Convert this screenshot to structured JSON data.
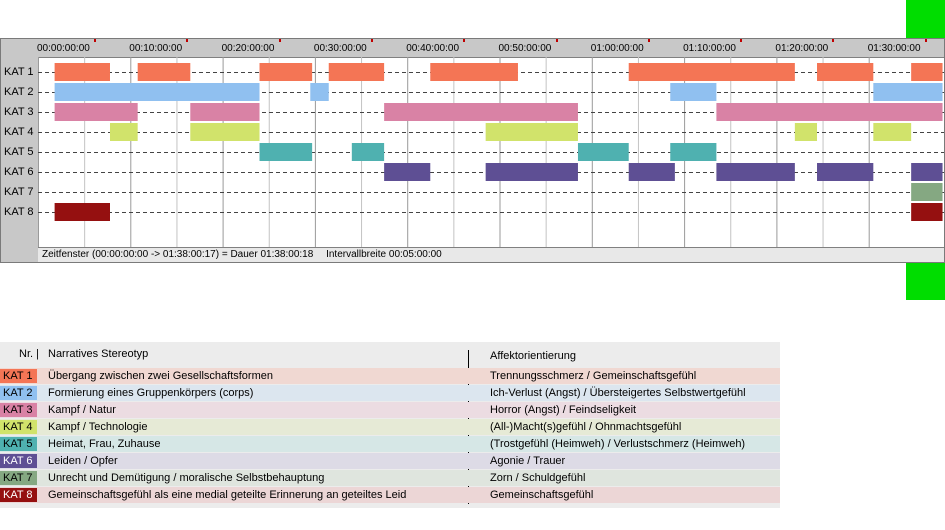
{
  "chart_data": {
    "type": "timeline",
    "categories": [
      "KAT 1",
      "KAT 2",
      "KAT 3",
      "KAT 4",
      "KAT 5",
      "KAT 6",
      "KAT 7",
      "KAT 8"
    ],
    "x_unit": "minutes",
    "xlim": [
      0,
      94.6
    ],
    "ticks": [
      {
        "min": 0,
        "label": "00:00:00:00"
      },
      {
        "min": 10,
        "label": "00:10:00:00"
      },
      {
        "min": 20,
        "label": "00:20:00:00"
      },
      {
        "min": 30,
        "label": "00:30:00:00"
      },
      {
        "min": 40,
        "label": "00:40:00:00"
      },
      {
        "min": 50,
        "label": "00:50:00:00"
      },
      {
        "min": 60,
        "label": "01:00:00:00"
      },
      {
        "min": 70,
        "label": "01:10:00:00"
      },
      {
        "min": 80,
        "label": "01:20:00:00"
      },
      {
        "min": 90,
        "label": "01:30:00:00"
      }
    ],
    "series": [
      {
        "color": "#f47555",
        "intervals": [
          [
            1.8,
            7.8
          ],
          [
            10.8,
            16.5
          ],
          [
            24,
            29.7
          ],
          [
            31.5,
            37.5
          ],
          [
            42.5,
            52
          ],
          [
            64,
            82
          ],
          [
            84.4,
            90.5
          ],
          [
            94.6,
            98
          ]
        ]
      },
      {
        "color": "#90c0f0",
        "intervals": [
          [
            1.8,
            24
          ],
          [
            29.5,
            31.5
          ],
          [
            68.5,
            73.5
          ],
          [
            90.5,
            98
          ]
        ]
      },
      {
        "color": "#d982a5",
        "intervals": [
          [
            1.8,
            10.8
          ],
          [
            16.5,
            24
          ],
          [
            37.5,
            58.5
          ],
          [
            73.5,
            98
          ]
        ]
      },
      {
        "color": "#d1e36b",
        "intervals": [
          [
            7.8,
            10.8
          ],
          [
            16.5,
            24
          ],
          [
            48.5,
            58.5
          ],
          [
            82,
            84.4
          ],
          [
            90.5,
            94.6
          ]
        ]
      },
      {
        "color": "#4fb1b0",
        "intervals": [
          [
            24,
            29.7
          ],
          [
            34,
            37.5
          ],
          [
            58.5,
            64
          ],
          [
            68.5,
            73.5
          ]
        ]
      },
      {
        "color": "#5e4f94",
        "intervals": [
          [
            37.5,
            42.5
          ],
          [
            48.5,
            58.5
          ],
          [
            64,
            69
          ],
          [
            73.5,
            82
          ],
          [
            84.4,
            90.5
          ],
          [
            94.6,
            98
          ]
        ]
      },
      {
        "color": "#85a882",
        "intervals": [
          [
            94.6,
            98
          ]
        ]
      },
      {
        "color": "#951010",
        "intervals": [
          [
            1.8,
            7.8
          ],
          [
            94.6,
            98
          ]
        ]
      }
    ]
  },
  "status": {
    "zeitfenster": "Zeitfenster (00:00:00:00 -> 01:38:00:17) = Dauer 01:38:00:18",
    "intervall": "Intervallbreite 00:05:00:00"
  },
  "legend": {
    "header_nr": "Nr. |",
    "header_stereotyp": "Narratives Stereotyp",
    "header_affekt": "Affektorientierung",
    "rows": [
      {
        "kat": "KAT 1",
        "badge": "#f47555",
        "bg": "#f0d8d2",
        "stereotyp": "Übergang zwischen zwei Gesellschaftsformen",
        "affekt": "Trennungsschmerz / Gemeinschaftsgefühl"
      },
      {
        "kat": "KAT 2",
        "badge": "#90c0f0",
        "bg": "#dce6ef",
        "stereotyp": "Formierung eines Gruppenkörpers (corps)",
        "affekt": "Ich-Verlust (Angst) / Übersteigertes Selbstwertgefühl"
      },
      {
        "kat": "KAT 3",
        "badge": "#d982a5",
        "bg": "#ecdce2",
        "stereotyp": "Kampf / Natur",
        "affekt": "Horror (Angst) / Feindseligkeit"
      },
      {
        "kat": "KAT 4",
        "badge": "#d1e36b",
        "bg": "#e6ead6",
        "stereotyp": "Kampf / Technologie",
        "affekt": "(All-)Macht(s)gefühl / Ohnmachtsgefühl"
      },
      {
        "kat": "KAT 5",
        "badge": "#4fb1b0",
        "bg": "#d6e7e6",
        "stereotyp": "Heimat, Frau, Zuhause",
        "affekt": "(Trostgefühl (Heimweh) / Verlustschmerz (Heimweh)"
      },
      {
        "kat": "KAT 6",
        "badge": "#5e4f94",
        "bg": "#dddbe6",
        "stereotyp": "Leiden / Opfer",
        "affekt": "Agonie / Trauer"
      },
      {
        "kat": "KAT 7",
        "badge": "#85a882",
        "bg": "#dfe5de",
        "stereotyp": "Unrecht und Demütigung / moralische Selbstbehauptung",
        "affekt": "Zorn / Schuldgefühl"
      },
      {
        "kat": "KAT 8",
        "badge": "#951010",
        "bg": "#ecd6d6",
        "stereotyp": "Gemeinschaftsgefühl als eine medial geteilte Erinnerung an geteiltes Leid",
        "affekt": "Gemeinschaftsgefühl"
      }
    ]
  }
}
